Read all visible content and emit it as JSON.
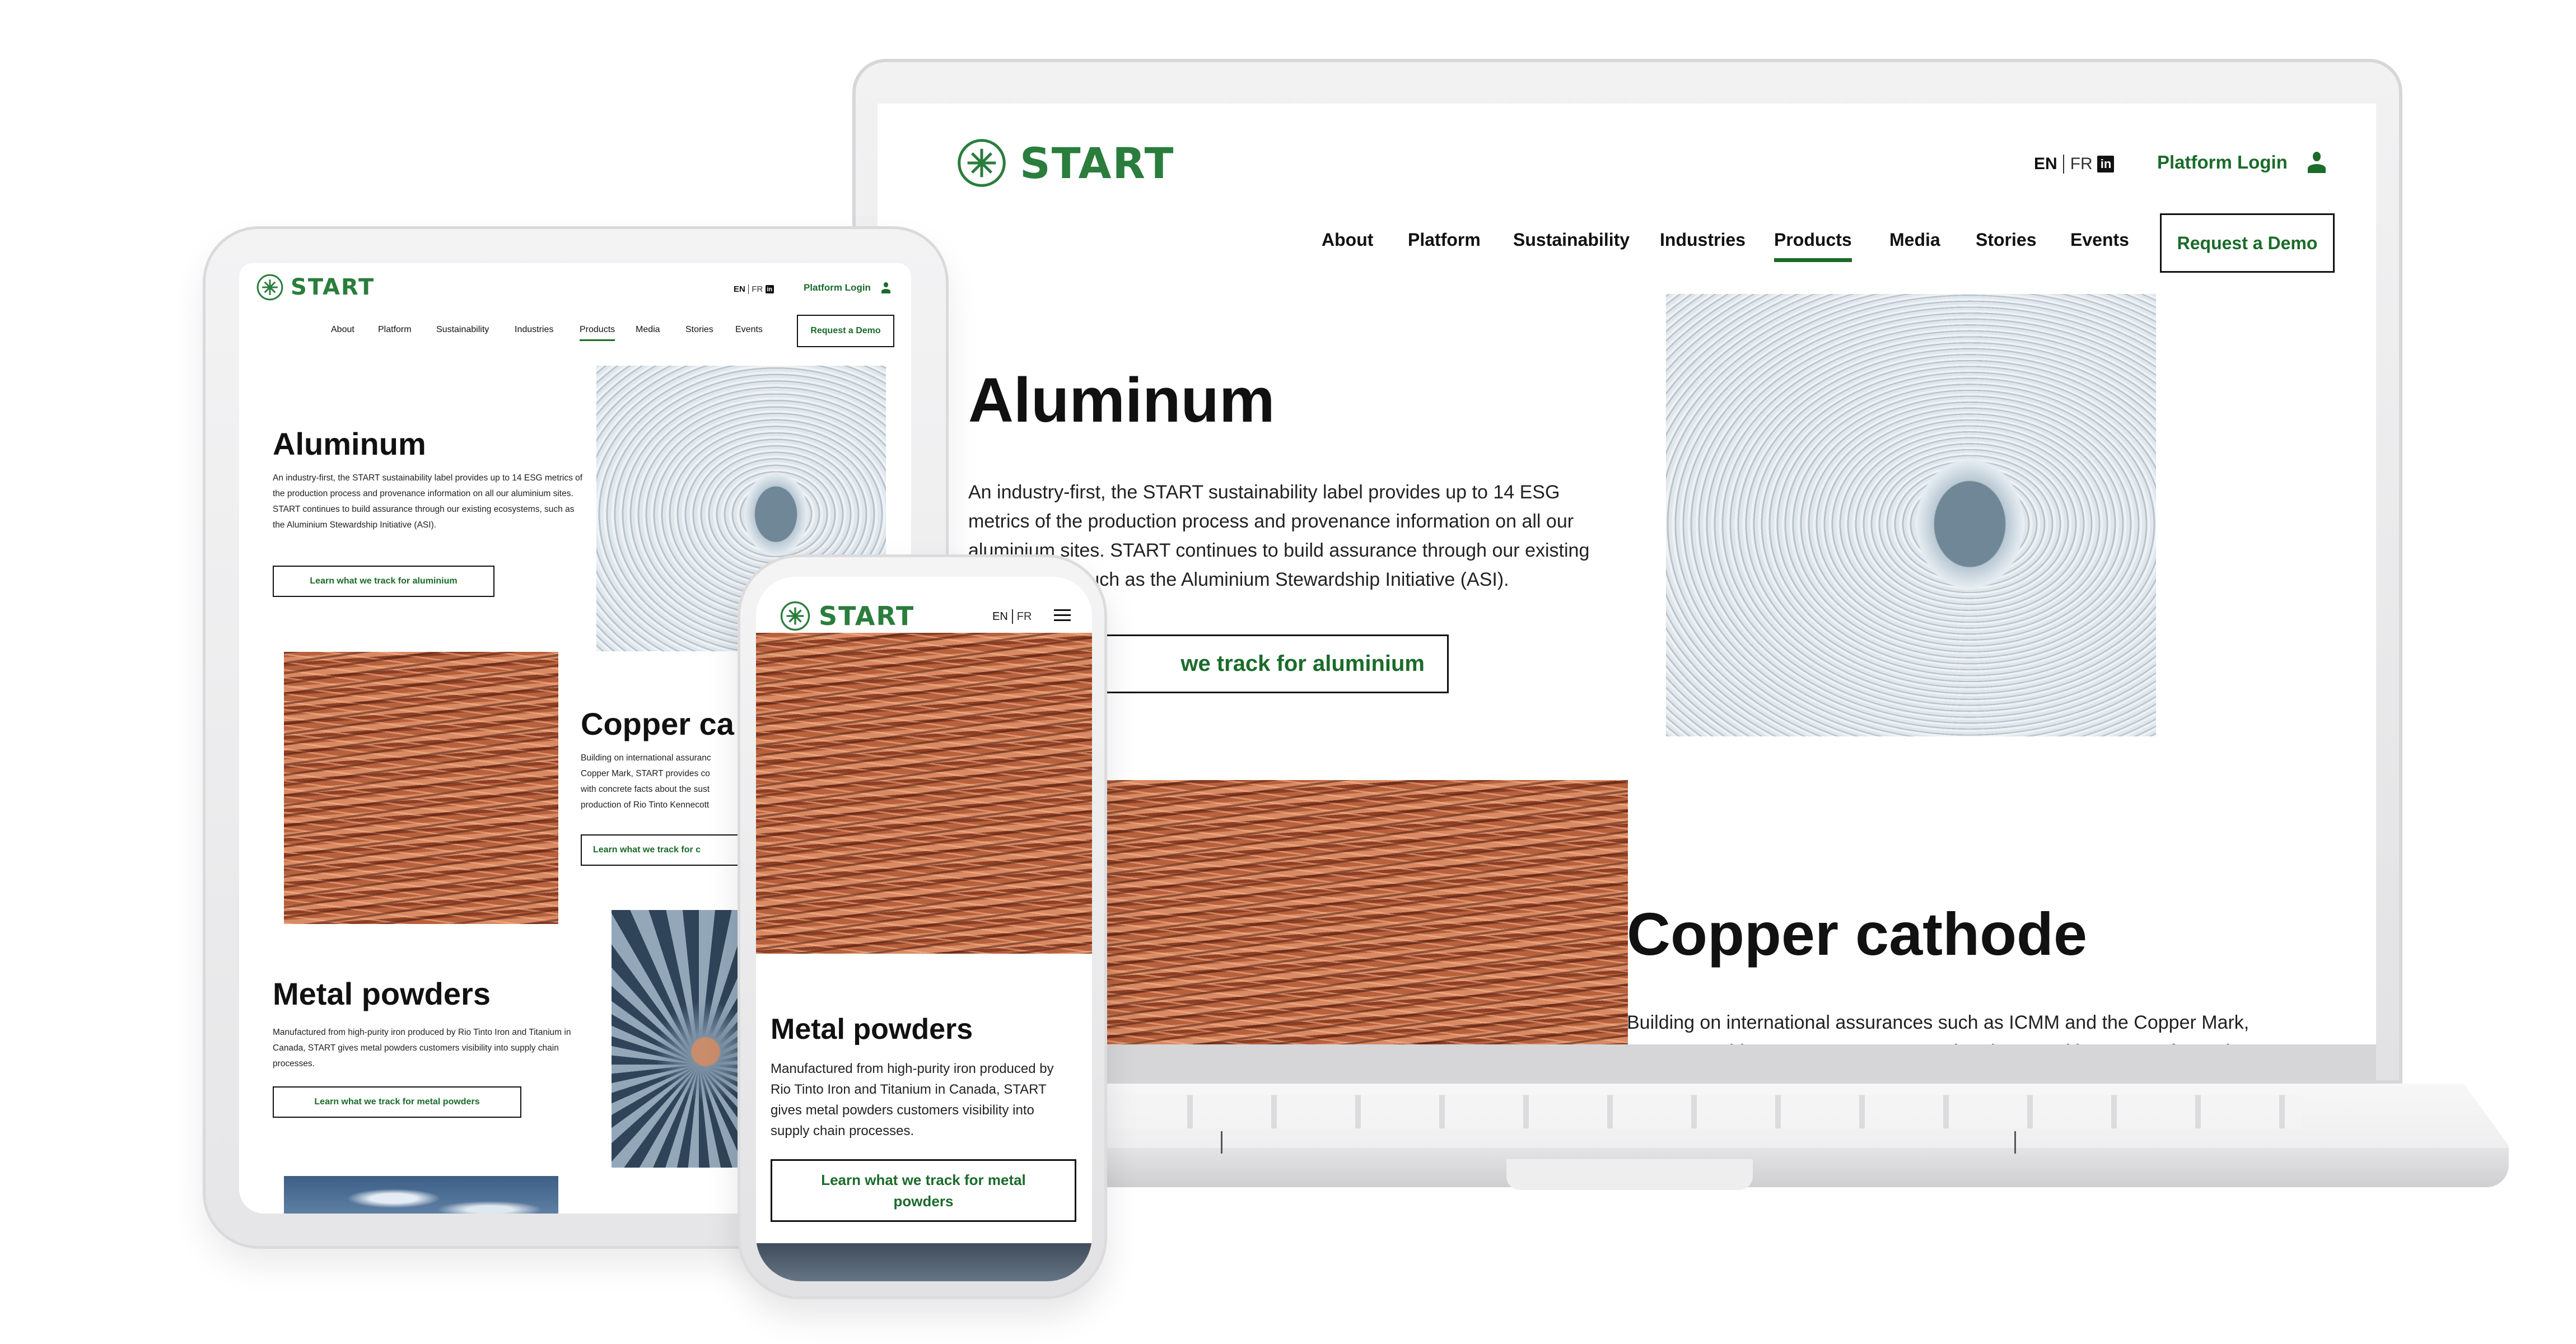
{
  "brand": {
    "name": "START",
    "logo_icon": "asterisk-circle-icon",
    "colors": {
      "primary_green": "#2a7d3c",
      "link_green": "#1b6b2a",
      "text": "#111111",
      "button_border": "#111111"
    }
  },
  "header": {
    "lang_en": "EN",
    "lang_separator": "|",
    "lang_fr": "FR",
    "social_icon": "linkedin-icon",
    "social_label": "in",
    "login_label": "Platform Login",
    "login_icon": "user-icon",
    "cta_label": "Request a Demo",
    "menu_icon": "hamburger-menu-icon"
  },
  "nav": {
    "items": [
      {
        "label": "About",
        "active": false
      },
      {
        "label": "Platform",
        "active": false
      },
      {
        "label": "Sustainability",
        "active": false
      },
      {
        "label": "Industries",
        "active": false
      },
      {
        "label": "Products",
        "active": true
      },
      {
        "label": "Media",
        "active": false
      },
      {
        "label": "Stories",
        "active": false
      },
      {
        "label": "Events",
        "active": false
      }
    ]
  },
  "products": {
    "aluminum": {
      "title": "Aluminum",
      "body": "An industry-first, the START sustainability label provides up to 14 ESG metrics of the production process and provenance information on all our aluminium sites. START continues to build assurance through our existing ecosystems, such as the Aluminium Stewardship Initiative (ASI).",
      "button": "Learn what we track for aluminium",
      "button_visible_on_laptop": "we track for aluminium",
      "image": "aluminium-coils-image"
    },
    "copper": {
      "title": "Copper cathode",
      "body_laptop": "Building on international assurances such as ICMM and the Copper Mark, START provides copper customers and end users with concrete facts about the sustainable sourcing and production of Rio Tinto Kennecott copper.",
      "title_tablet_visible": "Copper ca",
      "body_tablet_lines": [
        "Building on international assuranc",
        "Copper Mark, START provides co",
        "with concrete facts about the sust",
        "production of Rio Tinto Kennecott"
      ],
      "button_tablet_visible": "Learn what we track for c",
      "image": "copper-wire-image"
    },
    "metal_powders": {
      "title": "Metal powders",
      "body": "Manufactured from high-purity iron produced by Rio Tinto Iron and Titanium in Canada, START gives metal powders customers visibility into supply chain processes.",
      "button": "Learn what we track for metal powders",
      "image": "metal-powder-turbine-image"
    }
  }
}
